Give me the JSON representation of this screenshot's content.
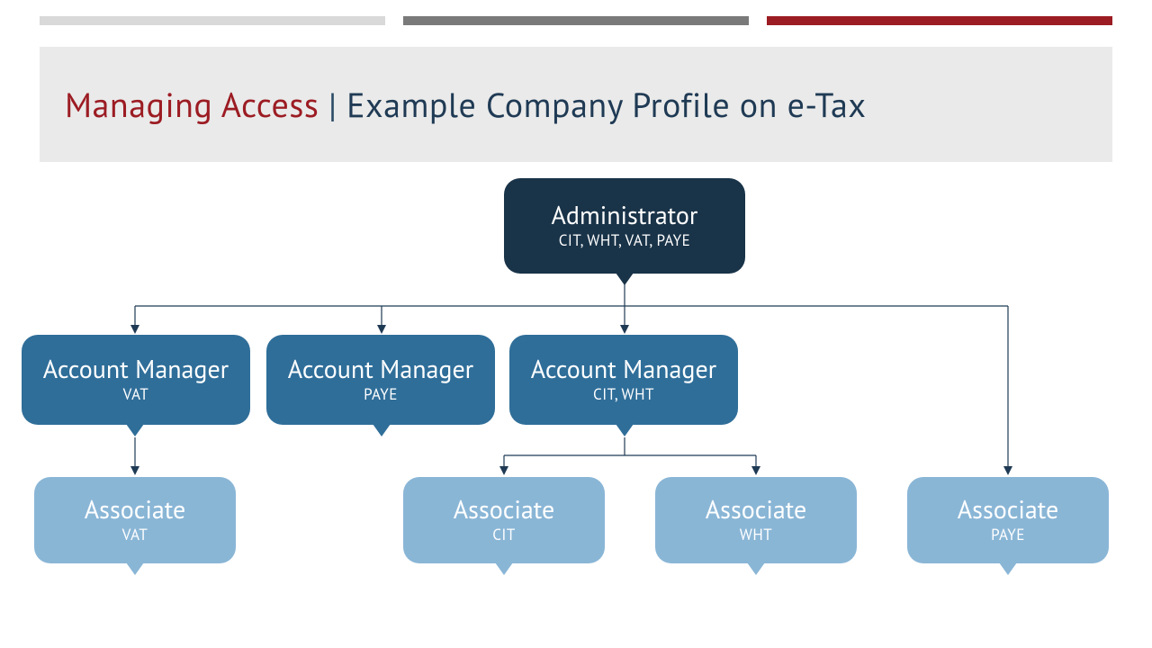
{
  "colors": {
    "bar_light": "#d9d9d9",
    "bar_mid": "#7a7a7a",
    "bar_red": "#9c1c23",
    "header_bg": "#eaeaea",
    "title_red": "#9c1c23",
    "title_blue": "#1f3a54",
    "node_dark": "#193348",
    "node_med": "#2f6e99",
    "node_light": "#8ab6d6"
  },
  "header": {
    "title_left": "Managing Access",
    "separator": " | ",
    "title_right": "Example Company Profile on e-Tax"
  },
  "nodes": {
    "admin": {
      "role": "Administrator",
      "sub": "CIT, WHT, VAT, PAYE"
    },
    "mgr_vat": {
      "role": "Account Manager",
      "sub": "VAT"
    },
    "mgr_paye": {
      "role": "Account Manager",
      "sub": "PAYE"
    },
    "mgr_cit": {
      "role": "Account Manager",
      "sub": "CIT, WHT"
    },
    "assoc_vat": {
      "role": "Associate",
      "sub": "VAT"
    },
    "assoc_cit": {
      "role": "Associate",
      "sub": "CIT"
    },
    "assoc_wht": {
      "role": "Associate",
      "sub": "WHT"
    },
    "assoc_paye": {
      "role": "Associate",
      "sub": "PAYE"
    }
  }
}
